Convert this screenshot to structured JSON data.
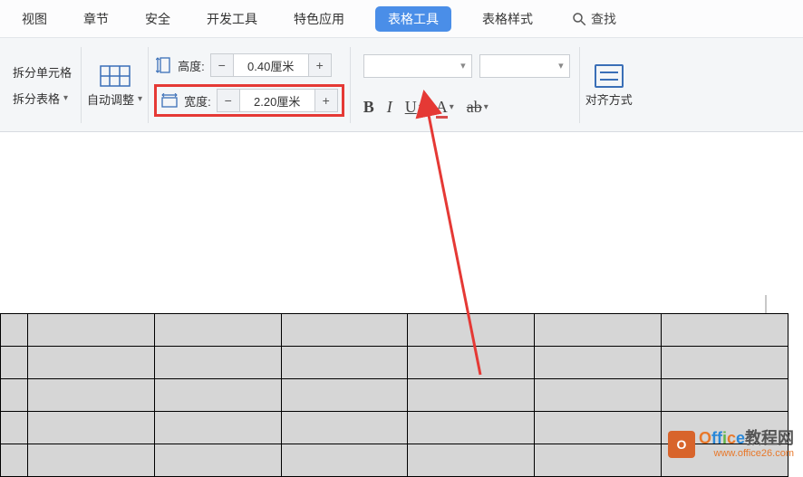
{
  "tabs": {
    "items": [
      "视图",
      "章节",
      "安全",
      "开发工具",
      "特色应用",
      "表格工具",
      "表格样式"
    ],
    "active_index": 5,
    "search_label": "查找"
  },
  "ribbon": {
    "split_cells": "拆分单元格",
    "split_table": "拆分表格",
    "auto_fit": "自动调整",
    "height_label": "高度:",
    "height_value": "0.40厘米",
    "width_label": "宽度:",
    "width_value": "2.20厘米",
    "minus": "−",
    "plus": "+",
    "bold": "B",
    "italic": "I",
    "underline": "U",
    "font_color": "A",
    "highlight": "ab",
    "alignment_label": "对齐方式"
  },
  "watermark": {
    "line1_prefix": "Office",
    "line1_suffix": "教程网",
    "line2": "www.office26.com"
  },
  "table": {
    "rows": 5,
    "cols": 7
  }
}
